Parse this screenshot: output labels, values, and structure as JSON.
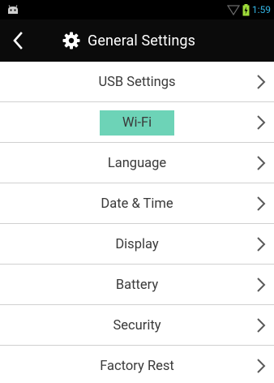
{
  "status_bar": {
    "time": "1:59",
    "left_icon": "android-debug-icon",
    "wifi_icon": "wifi-outline-icon",
    "battery_icon": "battery-charging-icon",
    "time_color": "#33b5e5"
  },
  "header": {
    "back_icon": "chevron-left-icon",
    "settings_icon": "gear-icon",
    "title": "General Settings",
    "background": "#0b0b0b"
  },
  "settings": {
    "items": [
      {
        "label": "USB Settings",
        "name": "usb-settings",
        "highlighted": false
      },
      {
        "label": "Wi-Fi",
        "name": "wifi",
        "highlighted": true
      },
      {
        "label": "Language",
        "name": "language",
        "highlighted": false
      },
      {
        "label": "Date & Time",
        "name": "date-time",
        "highlighted": false
      },
      {
        "label": "Display",
        "name": "display",
        "highlighted": false
      },
      {
        "label": "Battery",
        "name": "battery",
        "highlighted": false
      },
      {
        "label": "Security",
        "name": "security",
        "highlighted": false
      },
      {
        "label": "Factory Rest",
        "name": "factory-rest",
        "highlighted": false
      }
    ],
    "highlight_color": "#6dd3b7",
    "chevron_icon": "chevron-right-icon"
  }
}
